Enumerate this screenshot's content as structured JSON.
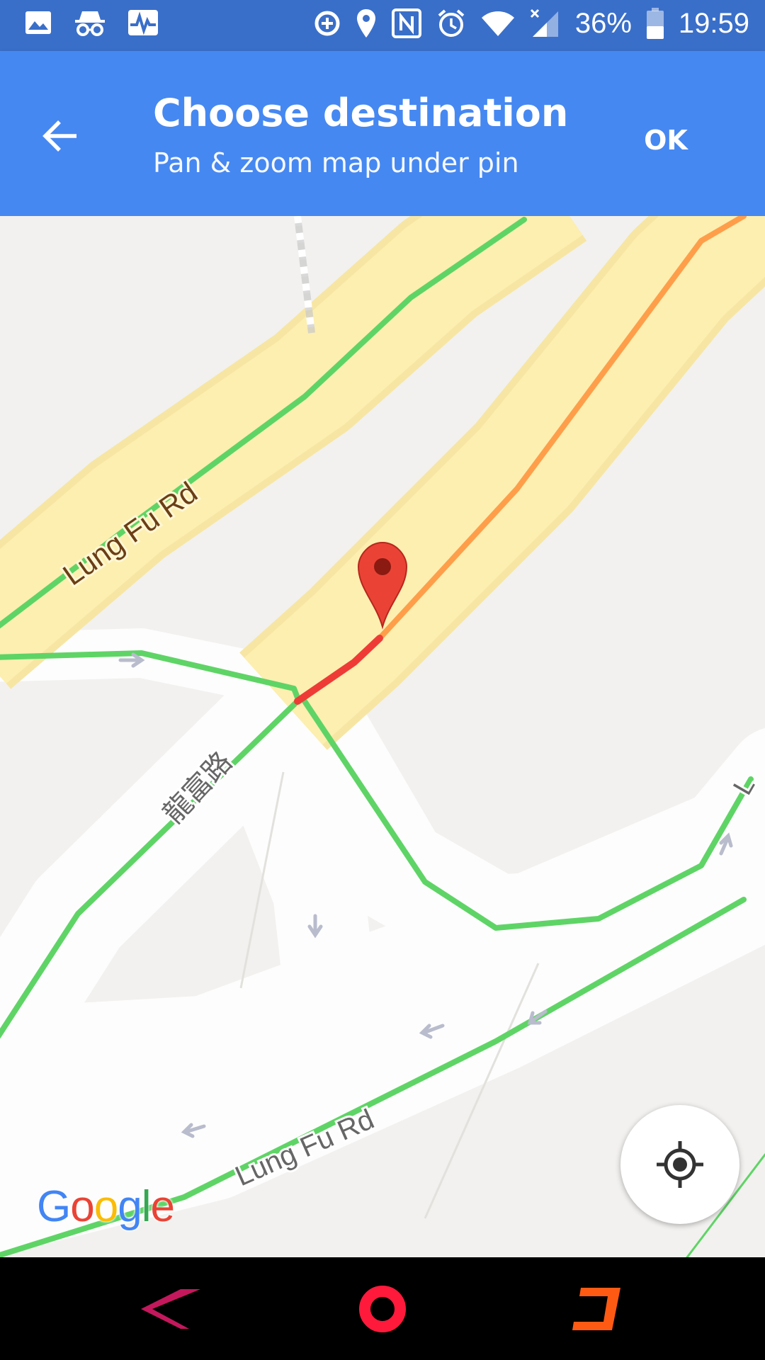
{
  "status_bar": {
    "battery_percent": "36%",
    "time": "19:59"
  },
  "app_bar": {
    "title": "Choose destination",
    "subtitle": "Pan & zoom map under pin",
    "ok_label": "OK"
  },
  "map": {
    "road_labels": {
      "upper": "Lung Fu Rd",
      "lower": "Lung Fu Rd",
      "chinese": "龍富路",
      "edge_partial": "L"
    },
    "traffic_colors": {
      "free_flow": "#5fd466",
      "slow": "#ff9e4a",
      "heavy": "#ef3b36"
    },
    "pin_color": "#ea4335",
    "logo": [
      "G",
      "o",
      "o",
      "g",
      "l",
      "e"
    ],
    "logo_colors": [
      "#4285f4",
      "#ea4335",
      "#fbbc05",
      "#4285f4",
      "#34a853",
      "#ea4335"
    ]
  },
  "nav_bar": {
    "back_color": "#c4185c",
    "home_color": "#ff1a3c",
    "recents_color": "#ff5a14"
  }
}
